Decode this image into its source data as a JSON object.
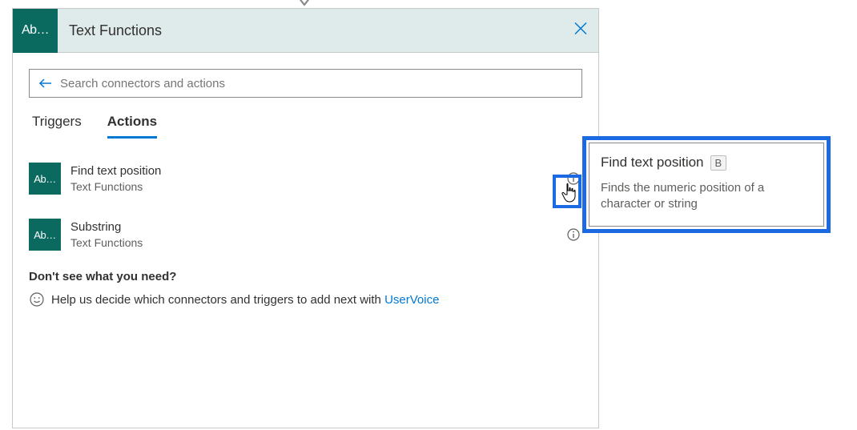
{
  "header": {
    "icon_text": "Ab…",
    "title": "Text Functions"
  },
  "search": {
    "placeholder": "Search connectors and actions"
  },
  "tabs": {
    "triggers": "Triggers",
    "actions": "Actions"
  },
  "actions": [
    {
      "icon_text": "Ab…",
      "title": "Find text position",
      "subtitle": "Text Functions"
    },
    {
      "icon_text": "Ab…",
      "title": "Substring",
      "subtitle": "Text Functions"
    }
  ],
  "hint": {
    "title": "Don't see what you need?",
    "text_before": "Help us decide which connectors and triggers to add next with ",
    "link": "UserVoice"
  },
  "tooltip": {
    "title": "Find text position",
    "badge": "B",
    "desc": "Finds the numeric position of a character or string"
  }
}
